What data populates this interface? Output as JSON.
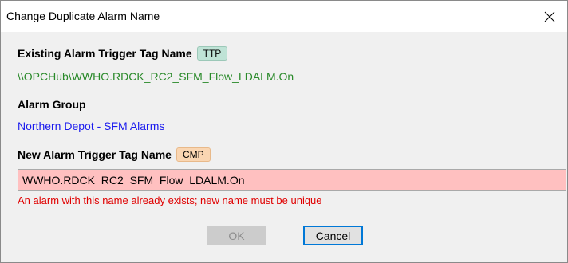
{
  "dialog": {
    "title": "Change Duplicate Alarm Name"
  },
  "existing_tag": {
    "label": "Existing Alarm Trigger Tag Name",
    "badge": "TTP",
    "value": "\\\\OPCHub\\WWHO.RDCK_RC2_SFM_Flow_LDALM.On",
    "value_color": "#2a8a2a"
  },
  "alarm_group": {
    "label": "Alarm Group",
    "value": "Northern Depot - SFM Alarms",
    "value_color": "#1a1aee"
  },
  "new_tag": {
    "label": "New Alarm Trigger Tag Name",
    "badge": "CMP",
    "input_value": "WWHO.RDCK_RC2_SFM_Flow_LDALM.On",
    "input_bg": "#ffc0c0",
    "error": "An alarm with this name already exists; new name must be unique"
  },
  "buttons": {
    "ok": "OK",
    "cancel": "Cancel"
  },
  "icons": {
    "close": "close-icon"
  }
}
